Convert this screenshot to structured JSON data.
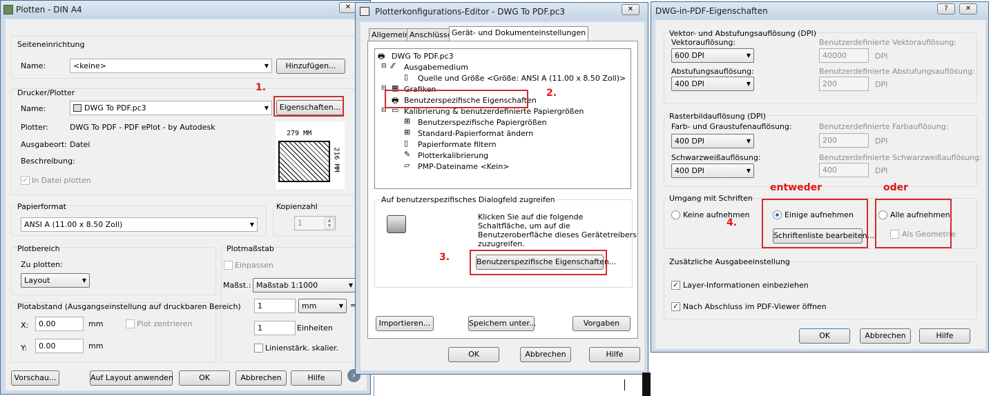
{
  "plot": {
    "title": "Plotten - DIN A4",
    "page_setup": {
      "group": "Seiteneinrichtung",
      "name_label": "Name:",
      "name_value": "<keine>",
      "add_button": "Hinzufügen..."
    },
    "printer": {
      "group": "Drucker/Plotter",
      "name_label": "Name:",
      "name_value": "DWG To PDF.pc3",
      "properties_button": "Eigenschaften...",
      "plotter_label": "Plotter:",
      "plotter_value": "DWG To PDF - PDF ePlot - by Autodesk",
      "location_label": "Ausgabeort:",
      "location_value": "Datei",
      "description_label": "Beschreibung:",
      "plot_to_file": "In Datei plotten",
      "dim_width": "279 MM",
      "dim_height": "216 MM"
    },
    "paper": {
      "group": "Papierformat",
      "value": "ANSI A (11.00 x 8.50 Zoll)"
    },
    "copies": {
      "group": "Kopienzahl",
      "value": "1"
    },
    "area": {
      "group": "Plotbereich",
      "what_label": "Zu plotten:",
      "what_value": "Layout"
    },
    "scale": {
      "group": "Plotmaßstab",
      "fit": "Einpassen",
      "scale_label": "Maßst.:",
      "scale_value": "Maßstab 1:1000",
      "v1": "1",
      "unit": "mm",
      "eq": "=",
      "v2": "1",
      "units_label": "Einheiten",
      "lineweights": "Linienstärk. skalier."
    },
    "offset": {
      "group": "Plotabstand (Ausgangseinstellung auf druckbaren Bereich)",
      "x_label": "X:",
      "x_value": "0.00",
      "x_unit": "mm",
      "y_label": "Y:",
      "y_value": "0.00",
      "y_unit": "mm",
      "center": "Plot zentrieren"
    },
    "buttons": {
      "preview": "Vorschau...",
      "apply": "Auf Layout anwenden",
      "ok": "OK",
      "cancel": "Abbrechen",
      "help": "Hilfe"
    }
  },
  "editor": {
    "title": "Plotterkonfigurations-Editor - DWG To PDF.pc3",
    "tabs": [
      "Allgemein",
      "Anschlüsse",
      "Gerät- und Dokumenteinstellungen"
    ],
    "tree": [
      "DWG To PDF.pc3",
      "Ausgabemedium",
      "Quelle und Größe <Größe: ANSI A (11.00 x 8.50 Zoll)>",
      "Grafiken",
      "Benutzerspezifische Eigenschaften",
      "Kalibrierung & benutzerdefinierte Papiergrößen",
      "Benutzerspezifische Papiergrößen",
      "Standard-Papierformat ändern",
      "Papierformate filtern",
      "Plotterkalibrierung",
      "PMP-Dateiname <Kein>"
    ],
    "custom_group": "Auf benutzerspezifisches Dialogfeld zugreifen",
    "custom_text": [
      "Klicken Sie auf die folgende",
      "Schaltfläche, um auf die",
      "Benutzeroberfläche dieses Gerätetreibers",
      "zuzugreifen."
    ],
    "custom_button": "Benutzerspezifische Eigenschaften...",
    "import": "Importieren...",
    "save": "Speichern unter...",
    "defaults": "Vorgaben",
    "ok": "OK",
    "cancel": "Abbrechen",
    "help": "Hilfe"
  },
  "pdf": {
    "title": "DWG-in-PDF-Eigenschaften",
    "vector": {
      "group": "Vektor- und Abstufungsauflösung (DPI)",
      "vec_label": "Vektorauflösung:",
      "vec_value": "600 DPI",
      "custom_vec_label": "Benutzerdefinierte Vektorauflösung:",
      "custom_vec_value": "40000",
      "dpi1": "DPI",
      "grad_label": "Abstufungsauflösung:",
      "grad_value": "400 DPI",
      "custom_grad_label": "Benutzerdefinierte Abstufungsauflösung:",
      "custom_grad_value": "200",
      "dpi2": "DPI"
    },
    "raster": {
      "group": "Rasterbildauflösung (DPI)",
      "color_label": "Farb- und Graustufenauflösung:",
      "color_value": "400 DPI",
      "custom_color_label": "Benutzerdefinierte Farbauflösung:",
      "custom_color_value": "200",
      "dpi1": "DPI",
      "bw_label": "Schwarzweißauflösung:",
      "bw_value": "400 DPI",
      "custom_bw_label": "Benutzerdefinierte Schwarzweißauflösung:",
      "custom_bw_value": "400",
      "dpi2": "DPI"
    },
    "fonts": {
      "group": "Umgang mit Schriften",
      "none": "Keine aufnehmen",
      "some": "Einige aufnehmen",
      "all": "Alle aufnehmen",
      "edit_button": "Schriftenliste bearbeiten...",
      "as_geometry": "Als Geometrie"
    },
    "extra": {
      "group": "Zusätzliche Ausgabeeinstellung",
      "layers": "Layer-Informationen einbeziehen",
      "open_viewer": "Nach Abschluss im PDF-Viewer öffnen"
    },
    "ok": "OK",
    "cancel": "Abbrechen",
    "help": "Hilfe"
  },
  "annotations": {
    "a1": "1.",
    "a2": "2.",
    "a3": "3.",
    "a4": "4.",
    "either": "entweder",
    "or": "oder"
  },
  "colors": {
    "annotation": "#d22a2a",
    "window_frame": "#cfdbe8",
    "dialog_bg": "#f0f0f0"
  }
}
